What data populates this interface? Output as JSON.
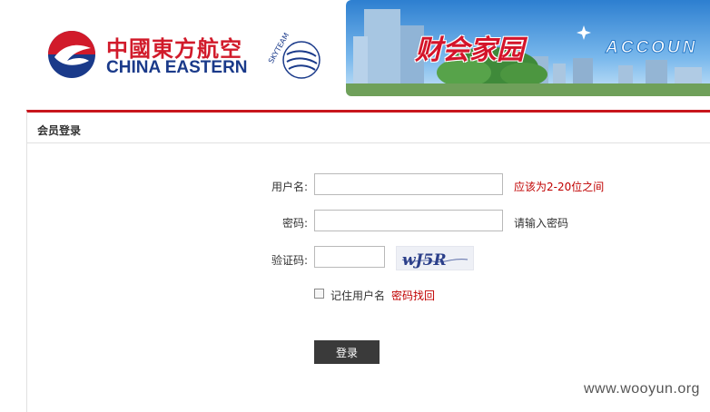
{
  "header": {
    "logo_cn": "中國東方航空",
    "logo_en": "CHINA EASTERN",
    "alliance_text": "SKYTEAM",
    "banner_title": "财会家园",
    "banner_en": "ACCOUN"
  },
  "panel": {
    "title": "会员登录"
  },
  "form": {
    "username_label": "用户名:",
    "username_value": "",
    "username_hint": "应该为2-20位之间",
    "password_label": "密码:",
    "password_value": "",
    "password_hint": "请输入密码",
    "captcha_label": "验证码:",
    "captcha_value": "",
    "captcha_text": "wJ5R",
    "remember_label": "记住用户名",
    "forgot_link": "密码找回",
    "login_button": "登录"
  },
  "watermark": "www.wooyun.org",
  "colors": {
    "brand_red": "#c8161d",
    "hint_red": "#c00000",
    "logo_blue": "#1a3a8a",
    "button_dark": "#3a3a3a"
  },
  "icons": {
    "logo": "china-eastern-swallow-icon",
    "alliance": "skyteam-globe-icon",
    "checkbox": "checkbox-unchecked"
  }
}
